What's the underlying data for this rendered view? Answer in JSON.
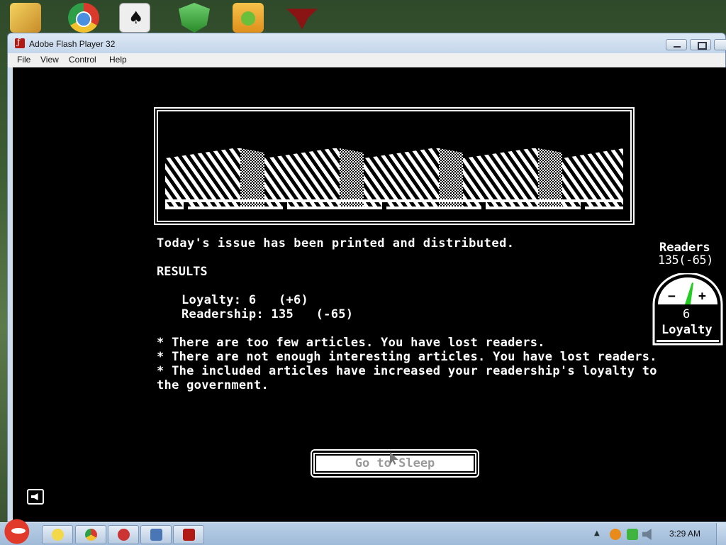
{
  "desktop": {
    "icons": [
      "photo-folder-icon",
      "chrome-icon",
      "solitaire-icon",
      "security-shield-icon",
      "bad-piggies-icon",
      "papers-please-icon"
    ]
  },
  "window": {
    "title": "Adobe Flash Player 32",
    "menu": [
      "File",
      "View",
      "Control",
      "Help"
    ]
  },
  "game": {
    "headline": "Today's issue has been printed and distributed.",
    "results_title": "RESULTS",
    "results": [
      "Loyalty: 6   (+6)",
      "Readership: 135   (-65)"
    ],
    "notes": [
      "* There are too few articles. You have lost readers.",
      "* There are not enough interesting articles. You have lost readers.",
      "* The included articles have increased your readership's loyalty to",
      "the government."
    ],
    "button_label": "Go to Sleep",
    "readers_label": "Readers",
    "readers_value": "135(-65)",
    "loyalty_value": "6",
    "loyalty_label": "Loyalty",
    "gauge_minus": "−",
    "gauge_plus": "+"
  },
  "taskbar": {
    "clock": "3:29 AM",
    "items": [
      "explorer-icon",
      "chrome-icon",
      "blocked-app-icon",
      "window-switcher-icon",
      "flash-player-icon"
    ]
  },
  "colors": {
    "stage_bg": "#000000",
    "text": "#ffffff",
    "gauge_needle": "#22cc22",
    "button_text": "#9a9a9a"
  }
}
